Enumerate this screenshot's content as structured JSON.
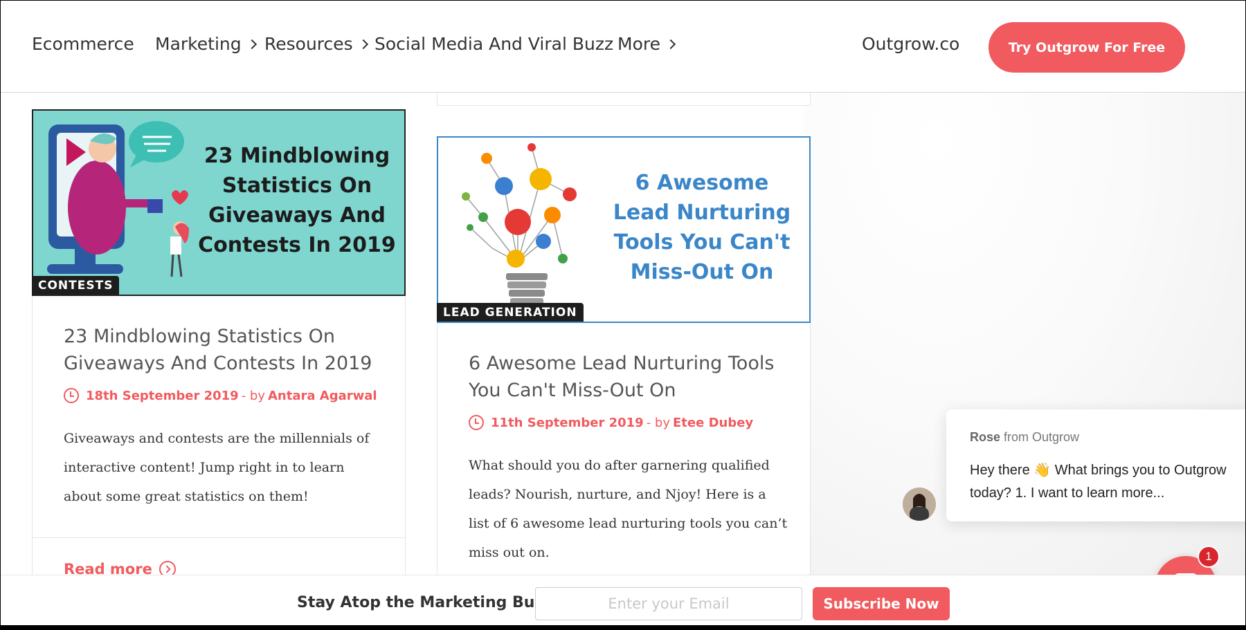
{
  "header": {
    "nav": [
      {
        "label": "Ecommerce",
        "has_submenu": false
      },
      {
        "label": "Marketing",
        "has_submenu": true
      },
      {
        "label": "Resources",
        "has_submenu": true
      },
      {
        "label": "Social Media And Viral Buzz",
        "has_submenu": false
      },
      {
        "label": "More",
        "has_submenu": true
      }
    ],
    "site_link": "Outgrow.co",
    "cta_label": "Try Outgrow For Free"
  },
  "posts": [
    {
      "category": "CONTESTS",
      "thumb_text": [
        "23 Mindblowing",
        "Statistics On",
        "Giveaways And",
        "Contests In 2019"
      ],
      "title": "23 Mindblowing Statistics On Giveaways And Contests In 2019",
      "date": "18th September 2019",
      "by": "- by",
      "author": "Antara Agarwal",
      "excerpt": "Giveaways and contests are the millennials of interactive content! Jump right in to learn about some great statistics on them!",
      "read_more": "Read more",
      "thumb_bg": "#7ed6cf"
    },
    {
      "category": "LEAD GENERATION",
      "thumb_text": [
        "6 Awesome",
        "Lead Nurturing",
        "Tools You Can't",
        "Miss-Out On"
      ],
      "title": "6 Awesome Lead Nurturing Tools You Can't Miss-Out On",
      "date": "11th September 2019",
      "by": "- by",
      "author": "Etee Dubey",
      "excerpt": "What should you do after garnering qualified leads? Nourish, nurture, and Njoy! Here is a list of 6 awesome lead nurturing tools you can’t miss out on.",
      "thumb_text_color": "#3a86c8"
    }
  ],
  "chat": {
    "agent_name": "Rose",
    "from_text": "from Outgrow",
    "message": "Hey there 👋 What brings you to Outgrow today? 1. I want to learn more...",
    "unread_count": "1"
  },
  "subscribe": {
    "label": "Stay Atop the Marketing Buzz",
    "placeholder": "Enter your Email",
    "button": "Subscribe Now"
  },
  "colors": {
    "accent": "#f15a5e",
    "badge_bg": "#1e1e1e",
    "lead_blue": "#3a86c8"
  }
}
